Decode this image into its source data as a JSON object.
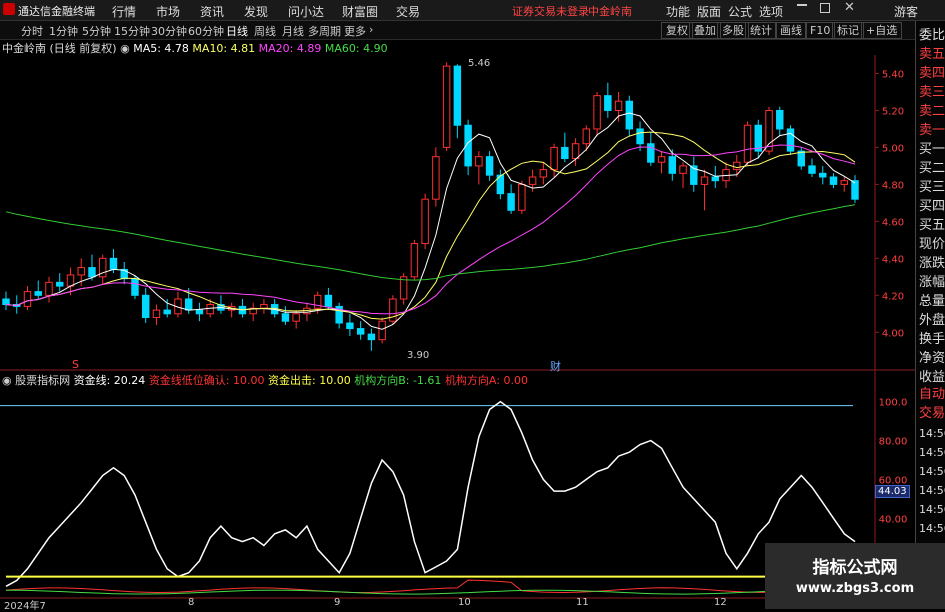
{
  "app": {
    "title": "通达信金融终端",
    "menus": [
      "行情",
      "市场",
      "资讯",
      "发现",
      "问小达",
      "财富圈",
      "交易"
    ],
    "broker_status": "证券交易未登录",
    "broker_name": "中金岭南",
    "right_menus": [
      "功能",
      "版面",
      "公式",
      "选项"
    ],
    "guest": "游客"
  },
  "toolbar": {
    "periods": [
      "分时",
      "1分钟",
      "5分钟",
      "15分钟",
      "30分钟",
      "60分钟",
      "日线",
      "周线",
      "月线",
      "多周期",
      "更多"
    ],
    "active_period": "日线",
    "buttons": [
      "复权",
      "叠加",
      "多股",
      "统计",
      "画线",
      "F10",
      "标记",
      "+自选"
    ]
  },
  "chart_header": {
    "stock": "中金岭南",
    "mode": "(日线 前复权)",
    "ma": [
      {
        "label": "MA5: 4.78",
        "color": "#ffffff"
      },
      {
        "label": "MA10: 4.81",
        "color": "#ffff66"
      },
      {
        "label": "MA20: 4.89",
        "color": "#ff44ff"
      },
      {
        "label": "MA60: 4.90",
        "color": "#44dd44"
      }
    ]
  },
  "indicator_header": {
    "name": "股票指标网",
    "items": [
      {
        "label": "资金线: 20.24",
        "color": "#ffffff"
      },
      {
        "label": "资金线低位确认: 10.00",
        "color": "#ff3333"
      },
      {
        "label": "资金出击: 10.00",
        "color": "#ffff44"
      },
      {
        "label": "机构方向B: -1.61",
        "color": "#44dd44"
      },
      {
        "label": "机构方向A: 0.00",
        "color": "#ff3333"
      }
    ]
  },
  "price_axis": [
    "5.40",
    "5.20",
    "5.00",
    "4.80",
    "4.60",
    "4.40",
    "4.20",
    "4.00"
  ],
  "price_annotations": {
    "high": "5.46",
    "low": "3.90"
  },
  "markers": {
    "s": "S",
    "cai": "财"
  },
  "indicator_axis": [
    "100.0",
    "80.00",
    "60.00",
    "40.00"
  ],
  "indicator_current": "44.03",
  "right_panel": [
    "委比",
    "卖五",
    "卖四",
    "卖三",
    "卖二",
    "卖一",
    "买一",
    "买二",
    "买三",
    "买四",
    "买五",
    "现价",
    "涨跌",
    "涨幅",
    "总量",
    "外盘",
    "换手",
    "净资",
    "收益"
  ],
  "right_panel_bottom": [
    "自动",
    "交易"
  ],
  "time_labels": [
    "14:56",
    "14:56",
    "14:56",
    "14:56",
    "14:56",
    "14:56",
    "14:56",
    "14:56",
    "14:56"
  ],
  "dates": [
    "2024年7",
    "8",
    "9",
    "10",
    "11",
    "12"
  ],
  "watermark": {
    "line1": "指标公式网",
    "line2": "www.zbgs3.com"
  },
  "colors": {
    "up": "#ff3030",
    "down": "#00d8ff",
    "ma5": "#ffffff",
    "ma10": "#ffff66",
    "ma20": "#ff44ff",
    "ma60": "#33cc33"
  },
  "chart_data": [
    {
      "type": "candlestick",
      "title": "中金岭南 (日线 前复权)",
      "ylim": [
        3.85,
        5.5
      ],
      "ohlc": [
        [
          4.18,
          4.22,
          4.12,
          4.15
        ],
        [
          4.15,
          4.2,
          4.1,
          4.14
        ],
        [
          4.14,
          4.25,
          4.12,
          4.22
        ],
        [
          4.22,
          4.28,
          4.18,
          4.2
        ],
        [
          4.2,
          4.3,
          4.16,
          4.27
        ],
        [
          4.27,
          4.32,
          4.22,
          4.25
        ],
        [
          4.25,
          4.35,
          4.2,
          4.31
        ],
        [
          4.31,
          4.4,
          4.25,
          4.35
        ],
        [
          4.35,
          4.42,
          4.28,
          4.3
        ],
        [
          4.3,
          4.42,
          4.26,
          4.4
        ],
        [
          4.4,
          4.45,
          4.32,
          4.34
        ],
        [
          4.34,
          4.38,
          4.26,
          4.29
        ],
        [
          4.29,
          4.31,
          4.18,
          4.2
        ],
        [
          4.2,
          4.24,
          4.05,
          4.08
        ],
        [
          4.08,
          4.15,
          4.04,
          4.12
        ],
        [
          4.12,
          4.18,
          4.08,
          4.1
        ],
        [
          4.1,
          4.22,
          4.08,
          4.18
        ],
        [
          4.18,
          4.24,
          4.1,
          4.12
        ],
        [
          4.12,
          4.16,
          4.06,
          4.1
        ],
        [
          4.1,
          4.18,
          4.08,
          4.15
        ],
        [
          4.15,
          4.2,
          4.1,
          4.12
        ],
        [
          4.12,
          4.16,
          4.08,
          4.14
        ],
        [
          4.14,
          4.18,
          4.08,
          4.1
        ],
        [
          4.1,
          4.16,
          4.06,
          4.13
        ],
        [
          4.13,
          4.18,
          4.1,
          4.15
        ],
        [
          4.15,
          4.18,
          4.08,
          4.1
        ],
        [
          4.1,
          4.14,
          4.04,
          4.06
        ],
        [
          4.06,
          4.12,
          4.02,
          4.1
        ],
        [
          4.1,
          4.16,
          4.06,
          4.13
        ],
        [
          4.13,
          4.22,
          4.1,
          4.2
        ],
        [
          4.2,
          4.24,
          4.12,
          4.14
        ],
        [
          4.14,
          4.16,
          4.02,
          4.05
        ],
        [
          4.05,
          4.1,
          3.98,
          4.02
        ],
        [
          4.02,
          4.06,
          3.96,
          3.99
        ],
        [
          3.99,
          4.02,
          3.9,
          3.96
        ],
        [
          3.96,
          4.08,
          3.94,
          4.06
        ],
        [
          4.06,
          4.2,
          4.04,
          4.18
        ],
        [
          4.18,
          4.32,
          4.15,
          4.3
        ],
        [
          4.3,
          4.5,
          4.28,
          4.48
        ],
        [
          4.48,
          4.75,
          4.45,
          4.72
        ],
        [
          4.72,
          5.0,
          4.68,
          4.95
        ],
        [
          5.0,
          5.46,
          4.98,
          5.44
        ],
        [
          5.44,
          5.45,
          5.05,
          5.12
        ],
        [
          5.12,
          5.15,
          4.85,
          4.9
        ],
        [
          4.9,
          4.98,
          4.8,
          4.95
        ],
        [
          4.95,
          4.98,
          4.82,
          4.85
        ],
        [
          4.85,
          4.88,
          4.72,
          4.75
        ],
        [
          4.75,
          4.8,
          4.64,
          4.66
        ],
        [
          4.66,
          4.82,
          4.64,
          4.8
        ],
        [
          4.8,
          4.88,
          4.76,
          4.84
        ],
        [
          4.84,
          4.92,
          4.8,
          4.88
        ],
        [
          4.88,
          5.02,
          4.84,
          5.0
        ],
        [
          5.0,
          5.08,
          4.92,
          4.94
        ],
        [
          4.94,
          5.05,
          4.9,
          5.02
        ],
        [
          5.02,
          5.12,
          4.98,
          5.1
        ],
        [
          5.1,
          5.3,
          5.06,
          5.28
        ],
        [
          5.28,
          5.35,
          5.16,
          5.2
        ],
        [
          5.2,
          5.3,
          5.14,
          5.25
        ],
        [
          5.25,
          5.28,
          5.06,
          5.1
        ],
        [
          5.1,
          5.14,
          4.98,
          5.02
        ],
        [
          5.02,
          5.08,
          4.9,
          4.92
        ],
        [
          4.92,
          4.98,
          4.86,
          4.95
        ],
        [
          4.95,
          4.99,
          4.82,
          4.86
        ],
        [
          4.86,
          4.92,
          4.78,
          4.9
        ],
        [
          4.9,
          4.95,
          4.76,
          4.8
        ],
        [
          4.8,
          4.88,
          4.66,
          4.84
        ],
        [
          4.84,
          4.9,
          4.78,
          4.82
        ],
        [
          4.82,
          4.92,
          4.78,
          4.88
        ],
        [
          4.88,
          4.96,
          4.84,
          4.92
        ],
        [
          4.92,
          5.14,
          4.9,
          5.12
        ],
        [
          5.12,
          5.15,
          4.94,
          4.98
        ],
        [
          4.98,
          5.22,
          4.96,
          5.2
        ],
        [
          5.2,
          5.22,
          5.06,
          5.1
        ],
        [
          5.1,
          5.12,
          4.96,
          4.98
        ],
        [
          4.98,
          5.0,
          4.88,
          4.9
        ],
        [
          4.9,
          4.94,
          4.84,
          4.86
        ],
        [
          4.86,
          4.9,
          4.8,
          4.84
        ],
        [
          4.84,
          4.86,
          4.78,
          4.8
        ],
        [
          4.8,
          4.84,
          4.76,
          4.82
        ],
        [
          4.82,
          4.85,
          4.7,
          4.72
        ]
      ]
    },
    {
      "type": "line",
      "title": "股票指标网",
      "ylim": [
        0,
        105
      ],
      "series": [
        {
          "name": "资金线",
          "values": [
            5,
            8,
            14,
            22,
            30,
            36,
            42,
            48,
            55,
            62,
            66,
            62,
            52,
            38,
            24,
            14,
            10,
            12,
            18,
            30,
            36,
            30,
            28,
            30,
            26,
            32,
            34,
            30,
            36,
            24,
            18,
            12,
            22,
            40,
            58,
            70,
            64,
            52,
            28,
            12,
            15,
            18,
            24,
            56,
            82,
            96,
            100,
            96,
            84,
            70,
            60,
            54,
            54,
            56,
            60,
            64,
            66,
            72,
            74,
            78,
            80,
            76,
            66,
            56,
            50,
            44,
            38,
            22,
            14,
            22,
            32,
            38,
            50,
            56,
            62,
            56,
            48,
            40,
            32,
            28
          ]
        },
        {
          "name": "资金出击",
          "values": [
            10,
            10,
            10,
            10,
            10,
            10,
            10,
            10,
            10,
            10,
            10,
            10,
            10,
            10,
            10,
            10,
            10,
            10,
            10,
            10,
            10,
            10,
            10,
            10,
            10,
            10,
            10,
            10,
            10,
            10,
            10,
            10,
            10,
            10,
            10,
            10,
            10,
            10,
            10,
            10,
            10,
            10,
            10,
            10,
            10,
            10,
            10,
            10,
            10,
            10,
            10,
            10,
            10,
            10,
            10,
            10,
            10,
            10,
            10,
            10,
            10,
            10,
            10,
            10,
            10,
            10,
            10,
            10,
            10,
            10,
            10,
            10,
            10,
            10,
            10,
            10,
            10,
            10,
            10,
            10
          ]
        }
      ]
    }
  ]
}
